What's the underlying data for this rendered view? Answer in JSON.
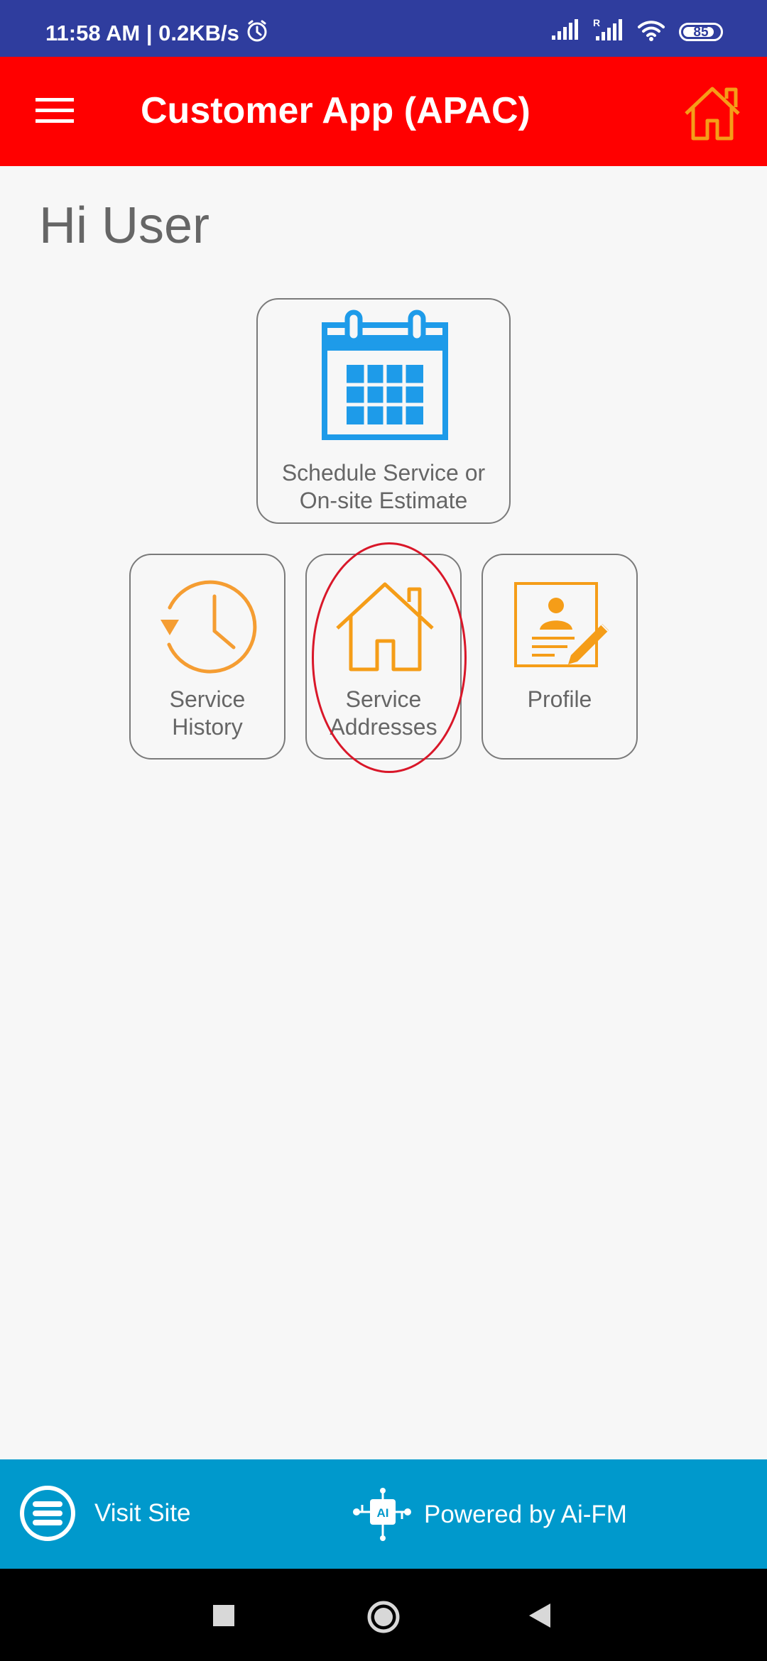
{
  "status_bar": {
    "time_speed": "11:58 AM | 0.2KB/s",
    "battery": "85",
    "battery_level": 0.85,
    "roaming_indicator": "R",
    "icons": [
      "alarm-icon",
      "signal-icon",
      "roaming-signal-icon",
      "wifi-icon",
      "battery-icon"
    ]
  },
  "app_bar": {
    "title": "Customer App (APAC)",
    "menu_icon": "hamburger-menu-icon",
    "home_icon": "home-icon"
  },
  "main": {
    "greeting": "Hi User",
    "tiles": [
      {
        "line1": "Schedule Service or",
        "line2": "On-site Estimate",
        "icon": "calendar-icon",
        "color": "#1e9be9"
      },
      {
        "line1": "Service",
        "line2": "History",
        "icon": "clock-history-icon",
        "color": "#f59d32"
      },
      {
        "line1": "Service",
        "line2": "Addresses",
        "icon": "house-icon",
        "color": "#f59d18"
      },
      {
        "line1": "Profile",
        "icon": "profile-edit-icon",
        "color": "#f59d18"
      }
    ]
  },
  "bottom_bar": {
    "visit_site": "Visit Site",
    "powered_by": "Powered by Ai-FM",
    "ai_badge": "AI"
  },
  "navigation": {
    "icons": [
      "recent-apps-icon",
      "home-circle-icon",
      "back-icon"
    ]
  },
  "colors": {
    "status_bar": "#2f3d9e",
    "app_bar": "#ff0000",
    "home_icon": "#f59d18",
    "background": "#f7f7f7",
    "text_gray": "#666666",
    "bottom_bar": "#0099cc",
    "annotation_circle": "#d91729"
  }
}
